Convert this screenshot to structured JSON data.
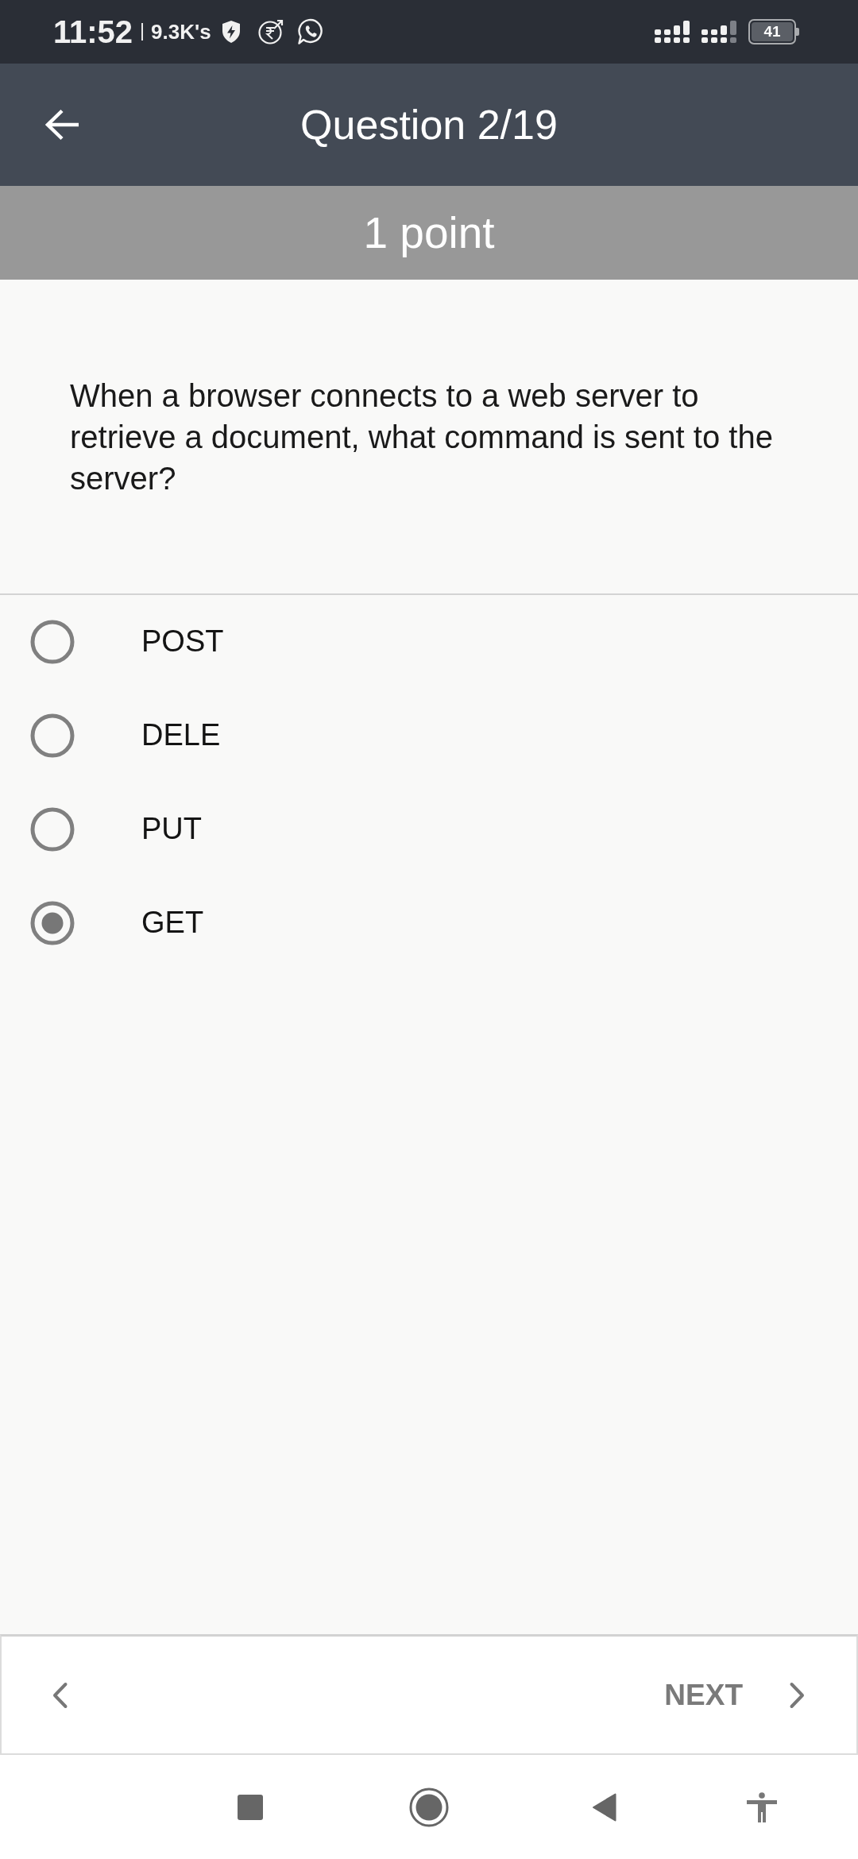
{
  "status_bar": {
    "time": "11:52",
    "data_speed": "9.3K's",
    "battery": "41"
  },
  "header": {
    "title": "Question 2/19"
  },
  "points": "1 point",
  "question": "When a browser connects to a web server to retrieve a document, what command is sent to the server?",
  "options": [
    {
      "label": "POST",
      "selected": false
    },
    {
      "label": "DELE",
      "selected": false
    },
    {
      "label": "PUT",
      "selected": false
    },
    {
      "label": "GET",
      "selected": true
    }
  ],
  "footer": {
    "next_label": "NEXT"
  }
}
